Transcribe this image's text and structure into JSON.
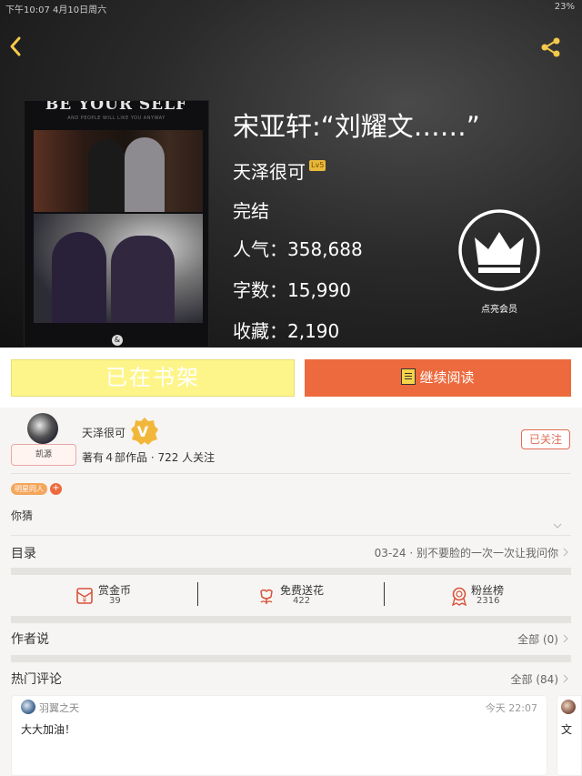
{
  "status_bar": {
    "left": "下午10:07  4月10日周六",
    "right": "23%"
  },
  "cover": {
    "title": "BE YOUR SELF",
    "subtitle": "AND PEOPLE WILL LIKE YOU ANYWAY",
    "logo": "&"
  },
  "book": {
    "title": "宋亚轩:“刘耀文……”",
    "author": "天泽很可",
    "author_level": "Lv5",
    "status": "完结",
    "popularity": "人气：358,688",
    "word_count": "字数：15,990",
    "favorites": "收藏：2,190"
  },
  "vip": {
    "label": "点亮会员"
  },
  "actions": {
    "shelf_label": "已在书架",
    "read_label": "继续阅读"
  },
  "author_card": {
    "name": "天泽很可",
    "avatar_tag": "凯源",
    "meta": "著有４部作品 · 722 人关注",
    "follow_label": "已关注",
    "v_mark": "V"
  },
  "tags": {
    "tag1": "明星同人",
    "plus": "+"
  },
  "intro": "你猜",
  "catalog": {
    "label": "目录",
    "latest": "03-24 · 别不要脸的一次一次让我问你"
  },
  "stats": {
    "coin_label": "赏金币",
    "coin_value": "39",
    "flower_label": "免费送花",
    "flower_value": "422",
    "fans_label": "粉丝榜",
    "fans_value": "2316"
  },
  "author_says": {
    "label": "作者说",
    "right": "全部 (0)"
  },
  "hot_comments": {
    "label": "热门评论",
    "right": "全部 (84)"
  },
  "comments": [
    {
      "name": "羽翼之天",
      "time": "今天 22:07",
      "text": "大大加油！"
    },
    {
      "text": "文"
    }
  ],
  "colors": {
    "accent": "#ec6a3d",
    "shelf_bg": "#fdf58a",
    "level_badge": "#e7b93b",
    "follow_border": "#e26c56"
  }
}
